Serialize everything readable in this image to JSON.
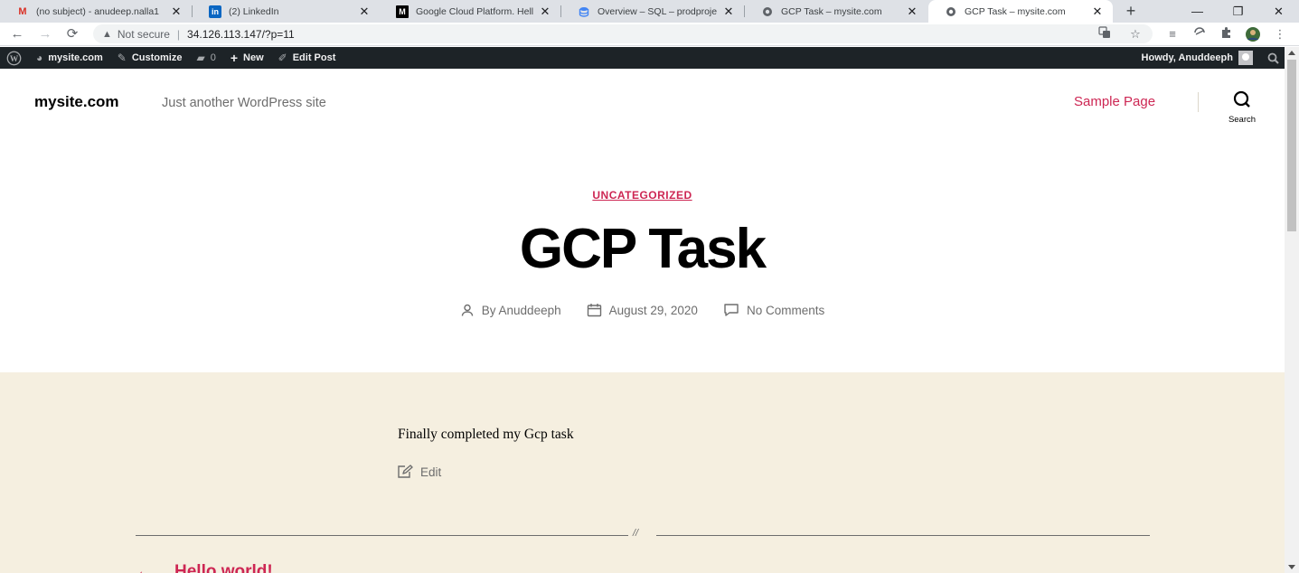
{
  "browser": {
    "tabs": [
      {
        "title": "(no subject) - anudeep.nalla1",
        "favicon": "gmail-icon",
        "active": false
      },
      {
        "title": "(2) LinkedIn",
        "favicon": "linkedin-icon",
        "active": false
      },
      {
        "title": "Google Cloud Platform. Hello",
        "favicon": "medium-icon",
        "active": false
      },
      {
        "title": "Overview – SQL – prodproject",
        "favicon": "cloud-sql-icon",
        "active": false
      },
      {
        "title": "GCP Task – mysite.com",
        "favicon": "globe-icon",
        "active": false
      },
      {
        "title": "GCP Task – mysite.com",
        "favicon": "globe-icon",
        "active": true
      }
    ],
    "address": {
      "security_label": "Not secure",
      "url": "34.126.113.147/?p=11"
    },
    "colors": {
      "tabstrip": "#dee1e6",
      "accent": "#cd2653"
    }
  },
  "adminbar": {
    "site_name": "mysite.com",
    "customize": "Customize",
    "comments_count": "0",
    "new_label": "New",
    "edit_post": "Edit Post",
    "howdy": "Howdy, Anuddeeph"
  },
  "header": {
    "site_title": "mysite.com",
    "site_description": "Just another WordPress site",
    "menu": [
      {
        "label": "Sample Page"
      }
    ],
    "search_label": "Search"
  },
  "post": {
    "category": "UNCATEGORIZED",
    "title": "GCP Task",
    "meta": {
      "author": "By Anuddeeph",
      "date": "August 29, 2020",
      "comments": "No Comments"
    },
    "content": "Finally completed my Gcp task",
    "edit_label": "Edit",
    "divider": "//",
    "prev_post": "Hello world!"
  }
}
